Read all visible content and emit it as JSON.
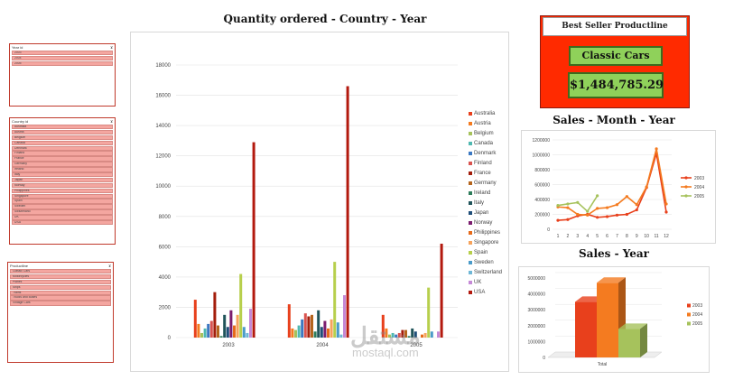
{
  "slicers": [
    {
      "title": "Year id",
      "items": [
        "2003",
        "2004",
        "2005"
      ]
    },
    {
      "title": "Country id",
      "items": [
        "Australia",
        "Austria",
        "Belgium",
        "Canada",
        "Denmark",
        "Finland",
        "France",
        "Germany",
        "Ireland",
        "Italy",
        "Japan",
        "Norway",
        "Philippines",
        "Singapore",
        "Spain",
        "Sweden",
        "Switzerland",
        "UK",
        "USA"
      ]
    },
    {
      "title": "Productline",
      "items": [
        "Classic Cars",
        "Motorcycles",
        "Planes",
        "Ships",
        "Trains",
        "Trucks and Buses",
        "Vintage Cars"
      ]
    }
  ],
  "kpi": {
    "title": "Best Seller Productline",
    "productline": "Classic Cars",
    "value": "$1,484,785.29"
  },
  "colors": {
    "accent": "#ff2a00",
    "kpi_green": "#8fd15a"
  },
  "watermark": {
    "arabic": "مستقل",
    "latin": "mostaql.com"
  },
  "chart_data": [
    {
      "type": "bar",
      "title": "Quantity ordered - Country - Year",
      "categories": [
        "2003",
        "2004",
        "2005"
      ],
      "ylim": [
        0,
        18000
      ],
      "yticks": [
        0,
        2000,
        4000,
        6000,
        8000,
        10000,
        12000,
        14000,
        16000,
        18000
      ],
      "grid": true,
      "legend": "right",
      "series": [
        {
          "name": "Australia",
          "color": "#e8401c",
          "values": [
            2500,
            2200,
            1500
          ]
        },
        {
          "name": "Austria",
          "color": "#f47b20",
          "values": [
            900,
            600,
            600
          ]
        },
        {
          "name": "Belgium",
          "color": "#a6c25c",
          "values": [
            300,
            500,
            200
          ]
        },
        {
          "name": "Canada",
          "color": "#4fb8b0",
          "values": [
            600,
            800,
            300
          ]
        },
        {
          "name": "Denmark",
          "color": "#3b78c2",
          "values": [
            900,
            1200,
            200
          ]
        },
        {
          "name": "Finland",
          "color": "#d9534f",
          "values": [
            1100,
            1600,
            300
          ]
        },
        {
          "name": "France",
          "color": "#a31d0b",
          "values": [
            3000,
            1400,
            500
          ]
        },
        {
          "name": "Germany",
          "color": "#b5651d",
          "values": [
            800,
            1500,
            500
          ]
        },
        {
          "name": "Ireland",
          "color": "#2e7d5b",
          "values": [
            100,
            400,
            100
          ]
        },
        {
          "name": "Italy",
          "color": "#20545a",
          "values": [
            1500,
            1800,
            600
          ]
        },
        {
          "name": "Japan",
          "color": "#1f4e79",
          "values": [
            700,
            700,
            400
          ]
        },
        {
          "name": "Norway",
          "color": "#7b1c6e",
          "values": [
            1800,
            1100,
            0
          ]
        },
        {
          "name": "Philippines",
          "color": "#e66a1a",
          "values": [
            800,
            600,
            200
          ]
        },
        {
          "name": "Singapore",
          "color": "#f6a35c",
          "values": [
            1500,
            1200,
            300
          ]
        },
        {
          "name": "Spain",
          "color": "#b7cf4c",
          "values": [
            4200,
            5000,
            3300
          ]
        },
        {
          "name": "Sweden",
          "color": "#4a9bc9",
          "values": [
            700,
            1000,
            400
          ]
        },
        {
          "name": "Switzerland",
          "color": "#6fb7d6",
          "values": [
            300,
            200,
            0
          ]
        },
        {
          "name": "UK",
          "color": "#c589d6",
          "values": [
            1900,
            2800,
            400
          ]
        },
        {
          "name": "USA",
          "color": "#b3190e",
          "values": [
            12900,
            16600,
            6200
          ]
        }
      ]
    },
    {
      "type": "line",
      "title": "Sales - Month - Year",
      "x": [
        1,
        2,
        3,
        4,
        5,
        6,
        7,
        8,
        9,
        10,
        11,
        12
      ],
      "ylim": [
        0,
        1200000
      ],
      "yticks": [
        0,
        200000,
        400000,
        600000,
        800000,
        1000000,
        1200000
      ],
      "grid": true,
      "legend": "right",
      "series": [
        {
          "name": "2003",
          "color": "#e8401c",
          "values": [
            120000,
            130000,
            180000,
            200000,
            160000,
            170000,
            190000,
            200000,
            260000,
            560000,
            1020000,
            230000
          ]
        },
        {
          "name": "2004",
          "color": "#f47b20",
          "values": [
            300000,
            290000,
            200000,
            190000,
            280000,
            290000,
            330000,
            440000,
            330000,
            570000,
            1080000,
            340000
          ]
        },
        {
          "name": "2005",
          "color": "#a6c25c",
          "values": [
            320000,
            340000,
            360000,
            240000,
            450000
          ]
        }
      ]
    },
    {
      "type": "bar",
      "title": "Sales - Year",
      "categories": [
        "Total"
      ],
      "ylim": [
        0,
        5000000
      ],
      "yticks": [
        0,
        1000000,
        2000000,
        3000000,
        4000000,
        5000000
      ],
      "grid": true,
      "legend": "right",
      "series": [
        {
          "name": "2003",
          "color": "#e8401c",
          "values": [
            3500000
          ]
        },
        {
          "name": "2004",
          "color": "#f47b20",
          "values": [
            4700000
          ]
        },
        {
          "name": "2005",
          "color": "#a6c25c",
          "values": [
            1800000
          ]
        }
      ]
    }
  ]
}
